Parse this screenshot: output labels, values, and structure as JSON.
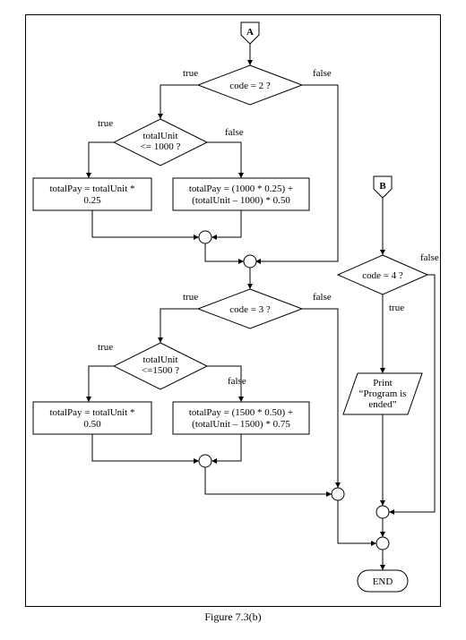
{
  "connector_a": "A",
  "connector_b": "B",
  "dec_code2": "code = 2 ?",
  "dec_code3": "code = 3 ?",
  "dec_code4": "code = 4 ?",
  "dec_unit1000_l1": "totalUnit",
  "dec_unit1000_l2": "<= 1000 ?",
  "dec_unit1500_l1": "totalUnit",
  "dec_unit1500_l2": "<=1500 ?",
  "proc_025_l1": "totalPay = totalUnit *",
  "proc_025_l2": "0.25",
  "proc_050stack_l1": "totalPay = (1000 * 0.25) +",
  "proc_050stack_l2": "(totalUnit – 1000) * 0.50",
  "proc_050_l1": "totalPay = totalUnit *",
  "proc_050_l2": "0.50",
  "proc_075_l1": "totalPay = (1500 * 0.50) +",
  "proc_075_l2": "(totalUnit – 1500) * 0.75",
  "print_l1": "Print",
  "print_l2": "“Program is",
  "print_l3": "ended”",
  "end": "END",
  "true": "true",
  "false": "false",
  "caption": "Figure 7.3(b)",
  "chart_data": {
    "type": "table",
    "title": "Flowchart of pay calculation (continuation with connectors A and B)",
    "nodes": [
      {
        "id": "A",
        "type": "offpage",
        "label": "A"
      },
      {
        "id": "B",
        "type": "offpage",
        "label": "B"
      },
      {
        "id": "d2",
        "type": "decision",
        "label": "code = 2 ?"
      },
      {
        "id": "d1000",
        "type": "decision",
        "label": "totalUnit <= 1000 ?"
      },
      {
        "id": "p025",
        "type": "process",
        "label": "totalPay = totalUnit * 0.25"
      },
      {
        "id": "p050s",
        "type": "process",
        "label": "totalPay = (1000 * 0.25) + (totalUnit – 1000) * 0.50"
      },
      {
        "id": "m1",
        "type": "merge"
      },
      {
        "id": "m2",
        "type": "merge"
      },
      {
        "id": "d3",
        "type": "decision",
        "label": "code = 3 ?"
      },
      {
        "id": "d1500",
        "type": "decision",
        "label": "totalUnit <= 1500 ?"
      },
      {
        "id": "p050",
        "type": "process",
        "label": "totalPay = totalUnit * 0.50"
      },
      {
        "id": "p075",
        "type": "process",
        "label": "totalPay = (1500 * 0.50) + (totalUnit – 1500) * 0.75"
      },
      {
        "id": "m3",
        "type": "merge"
      },
      {
        "id": "d4",
        "type": "decision",
        "label": "code = 4 ?"
      },
      {
        "id": "io",
        "type": "io",
        "label": "Print \"Program is ended\""
      },
      {
        "id": "m4",
        "type": "merge"
      },
      {
        "id": "m5",
        "type": "merge"
      },
      {
        "id": "m6",
        "type": "merge"
      },
      {
        "id": "end",
        "type": "terminator",
        "label": "END"
      }
    ],
    "edges": [
      {
        "from": "A",
        "to": "d2"
      },
      {
        "from": "d2",
        "to": "d1000",
        "label": "true"
      },
      {
        "from": "d2",
        "to": "m2",
        "label": "false"
      },
      {
        "from": "d1000",
        "to": "p025",
        "label": "true"
      },
      {
        "from": "d1000",
        "to": "p050s",
        "label": "false"
      },
      {
        "from": "p025",
        "to": "m1"
      },
      {
        "from": "p050s",
        "to": "m1"
      },
      {
        "from": "m1",
        "to": "m2"
      },
      {
        "from": "m2",
        "to": "d3"
      },
      {
        "from": "d3",
        "to": "d1500",
        "label": "true"
      },
      {
        "from": "d3",
        "to": "m4",
        "label": "false"
      },
      {
        "from": "d1500",
        "to": "p050",
        "label": "true"
      },
      {
        "from": "d1500",
        "to": "p075",
        "label": "false"
      },
      {
        "from": "p050",
        "to": "m3"
      },
      {
        "from": "p075",
        "to": "m3"
      },
      {
        "from": "m3",
        "to": "m4"
      },
      {
        "from": "B",
        "to": "d4"
      },
      {
        "from": "d4",
        "to": "io",
        "label": "true"
      },
      {
        "from": "d4",
        "to": "m5",
        "label": "false"
      },
      {
        "from": "io",
        "to": "m5"
      },
      {
        "from": "m4",
        "to": "m6"
      },
      {
        "from": "m5",
        "to": "m6"
      },
      {
        "from": "m6",
        "to": "end"
      }
    ]
  }
}
